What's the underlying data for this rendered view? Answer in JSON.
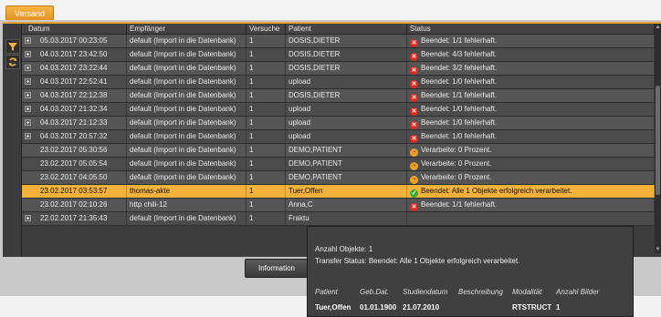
{
  "tab": {
    "label": "Versand"
  },
  "columns": {
    "datum": "Datum",
    "empfaenger": "Empfänger",
    "versuche": "Versuche",
    "patient": "Patient",
    "status": "Status"
  },
  "rows": [
    {
      "datum": "05.03.2017 00:23:05",
      "empfaenger": "default (Import in die Datenbank)",
      "versuche": "1",
      "patient": "DOSIS,DIETER",
      "status": "Beendet: 1/1 fehlerhaft.",
      "status_type": "error",
      "expandable": true
    },
    {
      "datum": "04.03.2017 23:42:50",
      "empfaenger": "default (Import in die Datenbank)",
      "versuche": "1",
      "patient": "DOSIS,DIETER",
      "status": "Beendet: 4/3 fehlerhaft.",
      "status_type": "error",
      "expandable": true
    },
    {
      "datum": "04.03.2017 23:22:44",
      "empfaenger": "default (Import in die Datenbank)",
      "versuche": "1",
      "patient": "DOSIS,DIETER",
      "status": "Beendet: 3/2 fehlerhaft.",
      "status_type": "error",
      "expandable": true
    },
    {
      "datum": "04.03.2017 22:52:41",
      "empfaenger": "default (Import in die Datenbank)",
      "versuche": "1",
      "patient": "upload",
      "status": "Beendet: 1/0 fehlerhaft.",
      "status_type": "error",
      "expandable": true
    },
    {
      "datum": "04.03.2017 22:12:38",
      "empfaenger": "default (Import in die Datenbank)",
      "versuche": "1",
      "patient": "DOSIS,DIETER",
      "status": "Beendet: 1/1 fehlerhaft.",
      "status_type": "error",
      "expandable": true
    },
    {
      "datum": "04.03.2017 21:32:34",
      "empfaenger": "default (Import in die Datenbank)",
      "versuche": "1",
      "patient": "upload",
      "status": "Beendet: 1/0 fehlerhaft.",
      "status_type": "error",
      "expandable": true
    },
    {
      "datum": "04.03.2017 21:12:33",
      "empfaenger": "default (Import in die Datenbank)",
      "versuche": "1",
      "patient": "upload",
      "status": "Beendet: 1/0 fehlerhaft.",
      "status_type": "error",
      "expandable": true
    },
    {
      "datum": "04.03.2017 20:57:32",
      "empfaenger": "default (Import in die Datenbank)",
      "versuche": "1",
      "patient": "upload",
      "status": "Beendet: 1/0 fehlerhaft.",
      "status_type": "error",
      "expandable": true
    },
    {
      "datum": "23.02.2017 05:30:56",
      "empfaenger": "default (Import in die Datenbank)",
      "versuche": "1",
      "patient": "DEMO,PATIENT",
      "status": "Verarbeite: 0 Prozent.",
      "status_type": "progress",
      "expandable": false
    },
    {
      "datum": "23.02.2017 05:05:54",
      "empfaenger": "default (Import in die Datenbank)",
      "versuche": "1",
      "patient": "DEMO,PATIENT",
      "status": "Verarbeite: 0 Prozent.",
      "status_type": "progress",
      "expandable": false
    },
    {
      "datum": "23.02.2017 04:05:50",
      "empfaenger": "default (Import in die Datenbank)",
      "versuche": "1",
      "patient": "DEMO,PATIENT",
      "status": "Verarbeite: 0 Prozent.",
      "status_type": "progress",
      "expandable": false
    },
    {
      "datum": "23.02.2017 03:53:57",
      "empfaenger": "thomas-akte",
      "versuche": "1",
      "patient": "Tuer,Offen",
      "status": "Beendet: Alle 1 Objekte erfolgreich verarbeitet.",
      "status_type": "ok",
      "expandable": false,
      "selected": true
    },
    {
      "datum": "23.02.2017 02:10:26",
      "empfaenger": "http chili-12",
      "versuche": "1",
      "patient": "Anna,C",
      "status": "Beendet: 1/1 fehlerhaft.",
      "status_type": "error",
      "expandable": false
    },
    {
      "datum": "22.02.2017 21:35:43",
      "empfaenger": "default (Import in die Datenbank)",
      "versuche": "1",
      "patient": "Fraktu",
      "status": "",
      "status_type": "none",
      "expandable": true
    }
  ],
  "buttons": {
    "information": "Information"
  },
  "tooltip": {
    "count": "Anzahl Objekte: 1",
    "transfer": "Transfer Status: Beendet: Alle 1 Objekte erfolgreich verarbeitet.",
    "headers": [
      "Patient",
      "Geb.Dat.",
      "Studiendatum",
      "Beschreibung",
      "Modalität",
      "Anzahl Bilder"
    ],
    "values": [
      "Tuer,Offen",
      "01.01.1900",
      "21.07.2010",
      "",
      "RTSTRUCT",
      "1"
    ]
  },
  "colors": {
    "accent": "#f4b23a",
    "error": "#e0281c",
    "ok": "#35b030",
    "progress": "#f0a021"
  }
}
